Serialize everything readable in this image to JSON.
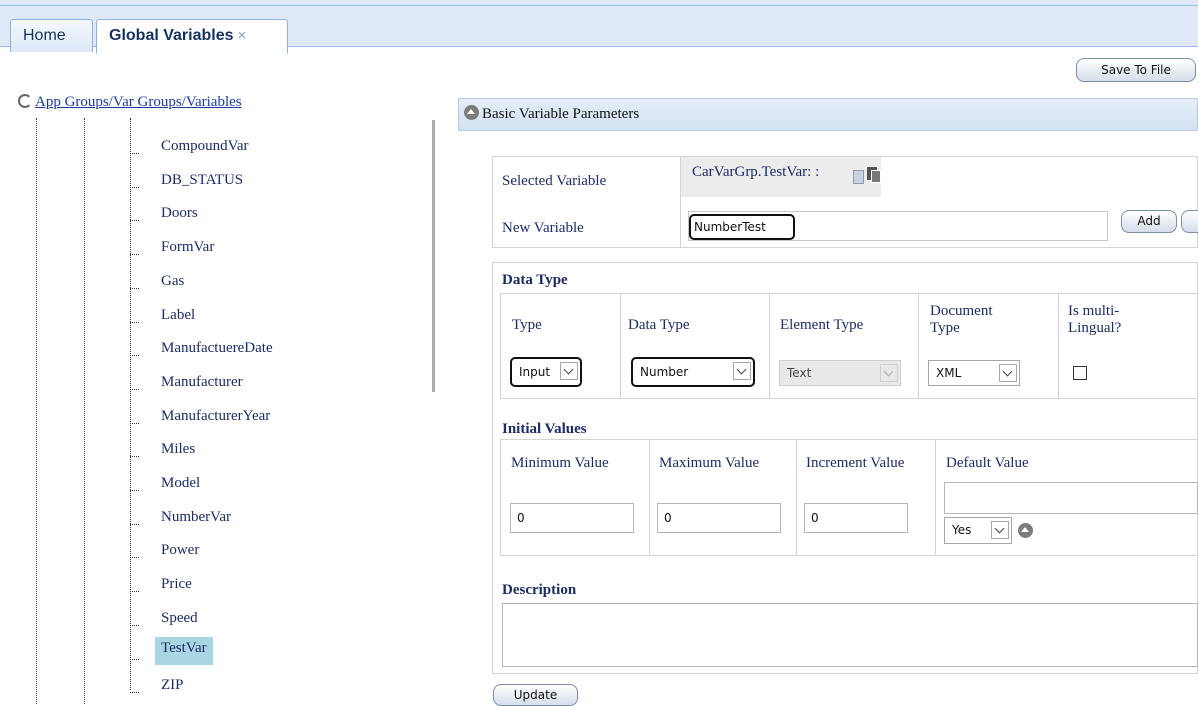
{
  "tabs": {
    "home": "Home",
    "global_variables": "Global Variables",
    "close_glyph": "×"
  },
  "toolbar": {
    "save_to_file": "Save To File"
  },
  "tree": {
    "root_label": "App Groups/Var Groups/Variables",
    "items": [
      "CompoundVar",
      "DB_STATUS",
      "Doors",
      "FormVar",
      "Gas",
      "Label",
      "ManufactuereDate",
      "Manufacturer",
      "ManufacturerYear",
      "Miles",
      "Model",
      "NumberVar",
      "Power",
      "Price",
      "Speed",
      "TestVar",
      "ZIP"
    ],
    "selected": "TestVar"
  },
  "panel": {
    "title": "Basic Variable Parameters",
    "selected_variable_label": "Selected Variable",
    "selected_variable_value": "CarVarGrp.TestVar: :",
    "new_variable_label": "New Variable",
    "new_variable_value": "NumberTest",
    "add_button": "Add",
    "data_type": {
      "section_title": "Data Type",
      "type_label": "Type",
      "type_value": "Input",
      "data_type_label": "Data Type",
      "data_type_value": "Number",
      "element_type_label": "Element Type",
      "element_type_value": "Text",
      "document_type_label_1": "Document",
      "document_type_label_2": "Type",
      "document_type_value": "XML",
      "multilingual_label_1": "Is multi-",
      "multilingual_label_2": "Lingual?",
      "multilingual_checked": false
    },
    "initial_values": {
      "section_title": "Initial Values",
      "min_label": "Minimum Value",
      "min_value": "0",
      "max_label": "Maximum Value",
      "max_value": "0",
      "inc_label": "Increment Value",
      "inc_value": "0",
      "default_label": "Default Value",
      "default_value": "",
      "default_select": "Yes"
    },
    "description": {
      "section_title": "Description",
      "value": ""
    },
    "update_button": "Update"
  },
  "colors": {
    "header_bg": "#dfe8f6",
    "selected_row": "#a9d6e2",
    "label_text": "#1c2c64"
  }
}
